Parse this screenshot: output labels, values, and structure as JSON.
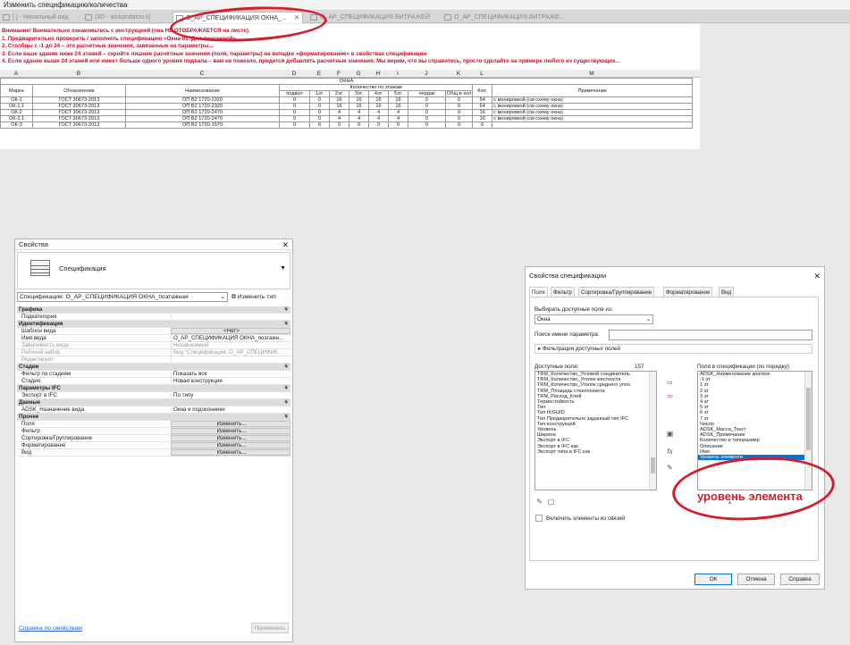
{
  "window_title": "Изменить спецификацию/количества",
  "tabs": [
    {
      "label": "[ ] - Начальный вид",
      "active": false
    },
    {
      "label": "{3D - aiskandarov.s}",
      "active": false
    },
    {
      "label": "О_АР_СПЕЦИФИКАЦИЯ ОКНА_...",
      "active": true
    },
    {
      "label": "О_АР_СПЕЦИФИКАЦИЯ ВИТРАЖЕЙ",
      "active": false
    },
    {
      "label": "О_АР_СПЕЦИФИКАЦИЯ ВИТРАЖЕ...",
      "active": false
    }
  ],
  "warnings": [
    "Внимание! Внимательно ознакомьтесь с инструкцией (она НЕ ОТОБРАЖАЕТСЯ на листе).",
    "1. Предварительно проверить / заполнить спецификацию «Окна-01. Для поэтажной».",
    "2. Столбцы с -1 до 24 – это расчетные значения, завязанные на параметры...",
    "3. Если ваше здание ниже 24 этажей – скройте лишние расчётные значения (поля, параметры) на вкладке «форматирование» в свойствах спецификации",
    "4. Если здание выше 24 этажей или имеет больше одного уровня подвала – вам не повезло, придется добавлять расчетные значения. Мы верим, что вы справитесь, просто сделайте на примере любого из существующих..."
  ],
  "sheet": {
    "column_letters": [
      "A",
      "B",
      "C",
      "D",
      "E",
      "F",
      "G",
      "H",
      "I",
      "J",
      "K",
      "L",
      "M"
    ],
    "group_title": "ОКНА",
    "sub_group": "Количество по этажам",
    "headers": [
      "Марка",
      "Обозначение",
      "Наименование",
      "подвал",
      "1эт.",
      "2эт.",
      "3эт.",
      "4эт.",
      "5эт.",
      "чердак",
      "Общ.в хол",
      "Кол.",
      "Примечание"
    ],
    "rows": [
      [
        "ОК-1",
        "ГОСТ 30673-2013",
        "ОП В2 1720-2320",
        "0",
        "0",
        "16",
        "16",
        "16",
        "16",
        "0",
        "0",
        "64",
        "с монировкой (см схему окна)"
      ],
      [
        "ОК-1.1",
        "ГОСТ 30673-2013",
        "ОП В2 1720-2320",
        "0",
        "0",
        "16",
        "16",
        "16",
        "16",
        "0",
        "0",
        "64",
        "с монировкой (см схему окна)"
      ],
      [
        "ОК-2",
        "ГОСТ 30673-2013",
        "ОП В2 1720-2470",
        "0",
        "0",
        "4",
        "4",
        "4",
        "4",
        "0",
        "0",
        "16",
        "с монировкой (см схему окна)"
      ],
      [
        "ОК-2.1",
        "ГОСТ 30673-2013",
        "ОП В2 1720-2470",
        "0",
        "0",
        "4",
        "4",
        "4",
        "4",
        "0",
        "0",
        "16",
        "с монировкой (см схему окна)"
      ],
      [
        "ОК-3",
        "ГОСТ 30673-2013",
        "ОП В2 1720-1570",
        "0",
        "6",
        "0",
        "0",
        "0",
        "0",
        "0",
        "0",
        "6",
        ""
      ]
    ]
  },
  "properties": {
    "title": "Свойства",
    "head_label": "Спецификация",
    "selector": "Спецификация: О_АР_СПЕЦИФИКАЦИЯ ОКНА_поэтажная",
    "edit_type": "Изменить тип",
    "rows": [
      {
        "cat": "Графика"
      },
      {
        "k": "Подкатегория",
        "v": ""
      },
      {
        "cat": "Идентификация"
      },
      {
        "k": "Шаблон вида",
        "v": "<Нет>",
        "btn": true
      },
      {
        "k": "Имя вида",
        "v": "О_АР_СПЕЦИФИКАЦИЯ ОКНА_поэтажн..."
      },
      {
        "k": "Зависимость вида",
        "v": "Независимый",
        "dis": true
      },
      {
        "k": "Рабочий набор",
        "v": "Вид \"Спецификация: О_АР_СПЕЦИФИК...",
        "dis": true
      },
      {
        "k": "Редактирует",
        "v": "",
        "dis": true
      },
      {
        "cat": "Стадии"
      },
      {
        "k": "Фильтр по стадиям",
        "v": "Показать все"
      },
      {
        "k": "Стадия",
        "v": "Новая конструкция"
      },
      {
        "cat": "Параметры IFC"
      },
      {
        "k": "Экспорт в IFC",
        "v": "По типу"
      },
      {
        "cat": "Данные"
      },
      {
        "k": "ADSK_Назначение вида",
        "v": "Окна и подоконники"
      },
      {
        "cat": "Прочее"
      },
      {
        "k": "Поля",
        "v": "Изменить...",
        "btn": true
      },
      {
        "k": "Фильтр",
        "v": "Изменить...",
        "btn": true
      },
      {
        "k": "Сортировка/Группирование",
        "v": "Изменить...",
        "btn": true
      },
      {
        "k": "Форматирование",
        "v": "Изменить...",
        "btn": true
      },
      {
        "k": "Вид",
        "v": "Изменить...",
        "btn": true
      }
    ],
    "help": "Справка по свойствам",
    "apply": "Применить"
  },
  "dialog": {
    "title": "Свойства спецификации",
    "tabs": [
      "Поля",
      "Фильтр",
      "Сортировка/Группирование",
      "Форматирование",
      "Вид"
    ],
    "select_from_label": "Выбирать доступные поля из:",
    "select_from_value": "Окна",
    "search_label": "Поиск имени параметра:",
    "filter_label": "Фильтрация доступных полей",
    "available_label": "Доступные поля:",
    "available_count": "157",
    "available": [
      "TRM_Количество_Угловой соединитель",
      "TRM_Количество_Уголок жесткости",
      "TRM_Количество_Уголок среднего упло",
      "TRM_Площадь стеклопакета",
      "TRM_Расход_Клей",
      "Термостойкость",
      "Тип",
      "Тип IfcGUID",
      "Тип Предварительно заданный тип IFC",
      "Тип конструкций",
      "Уровень",
      "Ширина",
      "Экспорт в IFC",
      "Экспорт в IFC как",
      "Экспорт типа в IFC как"
    ],
    "scheduled_label": "Поля в спецификации (по порядку):",
    "scheduled": [
      "ADSK_Наименование краткое",
      "-1 эт",
      "1 эт",
      "2 эт",
      "3 эт",
      "4 эт",
      "5 эт",
      "6 эт",
      "7 эт",
      "Число",
      "ADSK_Масса_Текст",
      "ADSK_Примечание",
      "Количество и типоразмер",
      "Описание",
      "Имя",
      "Уровень элемента"
    ],
    "include_links": "Включить элементы из связей",
    "ok": "ОК",
    "cancel": "Отмена",
    "help": "Справка"
  },
  "annotation": "уровень  элемента"
}
